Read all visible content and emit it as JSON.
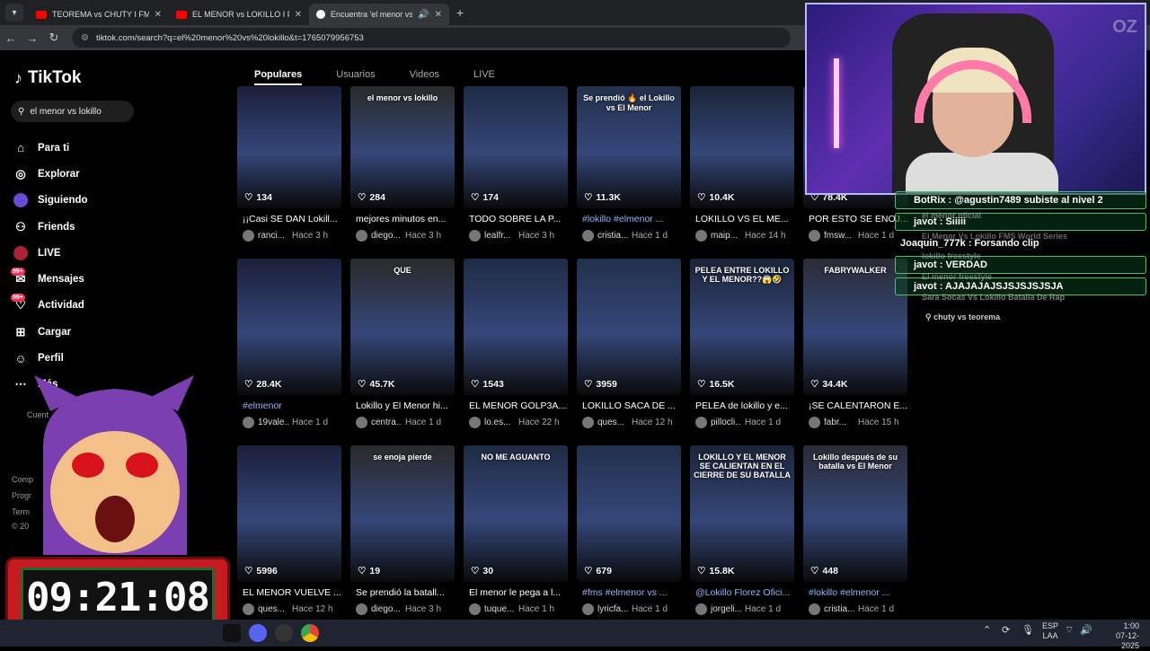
{
  "browser": {
    "tabs": [
      {
        "title": "TEOREMA vs CHUTY I FMS WO",
        "icon": "youtube-icon"
      },
      {
        "title": "EL MENOR vs LOKILLO I FMS W",
        "icon": "youtube-icon"
      },
      {
        "title": "Encuentra 'el menor vs loki",
        "icon": "tiktok-icon"
      }
    ],
    "url": "tiktok.com/search?q=el%20menor%20vs%20lokillo&t=1765079956753"
  },
  "sidebar": {
    "brand": "TikTok",
    "search_value": "el menor vs lokillo",
    "items": [
      {
        "label": "Para ti",
        "icon": "home-icon"
      },
      {
        "label": "Explorar",
        "icon": "compass-icon"
      },
      {
        "label": "Siguiendo",
        "icon": "following-avatar-icon"
      },
      {
        "label": "Friends",
        "icon": "friends-icon"
      },
      {
        "label": "LIVE",
        "icon": "live-icon"
      },
      {
        "label": "Mensajes",
        "icon": "messages-icon",
        "badge": "99+"
      },
      {
        "label": "Actividad",
        "icon": "activity-icon",
        "badge": "99+"
      },
      {
        "label": "Cargar",
        "icon": "upload-icon"
      },
      {
        "label": "Perfil",
        "icon": "profile-icon"
      },
      {
        "label": "Más",
        "icon": "more-icon"
      }
    ],
    "footer": [
      "Cuent",
      "Comp",
      "Progr",
      "Term",
      "© 20"
    ]
  },
  "search_tabs": [
    "Populares",
    "Usuarios",
    "Videos",
    "LIVE"
  ],
  "videos": [
    {
      "likes": "134",
      "caption": "¡¡Casi SE DAN Lokill...",
      "user": "ranci...",
      "time": "Hace 3 h",
      "hash": false
    },
    {
      "likes": "284",
      "caption": "mejores minutos en...",
      "user": "diego...",
      "time": "Hace 3 h",
      "hash": false,
      "overlay": "el menor vs lokillo"
    },
    {
      "likes": "174",
      "caption": "TODO SOBRE LA P...",
      "user": "lealfr...",
      "time": "Hace 3 h",
      "hash": false
    },
    {
      "likes": "11.3K",
      "caption": "#lokillo #elmenor ...",
      "user": "cristia...",
      "time": "Hace 1 d",
      "hash": true,
      "overlay": "Se prendió 🔥 el Lokillo vs El Menor"
    },
    {
      "likes": "10.4K",
      "caption": "LOKILLO VS EL ME...",
      "user": "maip...",
      "time": "Hace 14 h",
      "hash": false
    },
    {
      "likes": "78.4K",
      "caption": "POR ESTO SE ENOJ...",
      "user": "fmsw...",
      "time": "Hace 1 d",
      "hash": false
    },
    {
      "likes": "28.4K",
      "caption": "#elmenor",
      "user": "19vale...",
      "time": "Hace 1 d",
      "hash": true
    },
    {
      "likes": "45.7K",
      "caption": "Lokillo y El Menor hi...",
      "user": "centra...",
      "time": "Hace 1 d",
      "hash": false,
      "overlay": "QUE"
    },
    {
      "likes": "1543",
      "caption": "EL MENOR GOLP3A...",
      "user": "lo.es...",
      "time": "Hace 22 h",
      "hash": false
    },
    {
      "likes": "3959",
      "caption": "LOKILLO SACA DE ...",
      "user": "ques...",
      "time": "Hace 12 h",
      "hash": false
    },
    {
      "likes": "16.5K",
      "caption": "PELEA de lokillo y e...",
      "user": "pillocli...",
      "time": "Hace 1 d",
      "hash": false,
      "overlay": "PELEA ENTRE LOKILLO Y EL MENOR??😱🤣"
    },
    {
      "likes": "34.4K",
      "caption": "¡SE CALENTARON E...",
      "user": "fabr...",
      "time": "Hace 15 h",
      "hash": false,
      "overlay": "FABRYWALKER"
    },
    {
      "likes": "5996",
      "caption": "EL MENOR VUELVE ...",
      "user": "ques...",
      "time": "Hace 12 h",
      "hash": false
    },
    {
      "likes": "19",
      "caption": "Se prendió la batall...",
      "user": "diego...",
      "time": "Hace 3 h",
      "hash": false,
      "overlay": "se enoja pierde"
    },
    {
      "likes": "30",
      "caption": "El menor le pega a l...",
      "user": "tuque...",
      "time": "Hace 1 h",
      "hash": false,
      "overlay": "NO ME AGUANTO"
    },
    {
      "likes": "679",
      "caption": "#fms #elmenor vs ...",
      "user": "lyricfa...",
      "time": "Hace 1 d",
      "hash": true
    },
    {
      "likes": "15.8K",
      "caption": "@Lokillo Florez Ofici...",
      "user": "jorgeli...",
      "time": "Hace 1 d",
      "hash": true,
      "overlay": "LOKILLO Y EL MENOR SE CALIENTAN EN EL CIERRE DE SU BATALLA"
    },
    {
      "likes": "448",
      "caption": "#lokillo #elmenor ...",
      "user": "cristia...",
      "time": "Hace 1 d",
      "hash": true,
      "overlay": "Lokillo después de su batalla vs El Menor"
    }
  ],
  "chat": [
    {
      "text": "BotRix : @agustin7489 subiste al nivel 2",
      "boxed": true
    },
    {
      "text": "javot : Siiiii",
      "boxed": true
    },
    {
      "text": "Joaquin_777k : Forsando clip",
      "boxed": false
    },
    {
      "text": "javot : VERDAD",
      "boxed": true
    },
    {
      "text": "javot : AJAJAJAJSJSJSJSJSJA",
      "boxed": true
    }
  ],
  "suggestions_partial": [
    "el menor oficial",
    "El Menor Vs Lokillo FMS World Series",
    "lokillo freestyle",
    "El menor freestyle",
    "Sara Socas Vs Lokillo Batalla De Rap",
    "chuty vs teorema"
  ],
  "timer": "09:21:08",
  "taskbar": {
    "lang": "ESP",
    "lang2": "LAA",
    "time": "1:00",
    "date": "07-12-2025"
  },
  "colors": {
    "accent": "#fe2c55",
    "chat_border": "#3ec76b",
    "timer_bg": "#c41a20"
  }
}
